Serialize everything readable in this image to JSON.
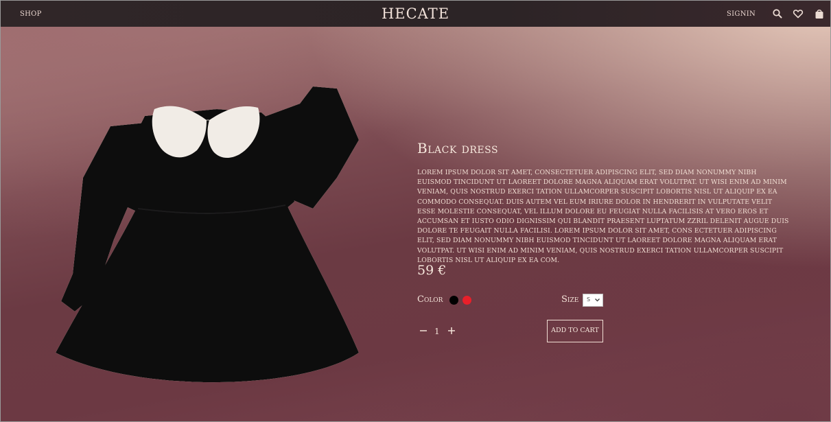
{
  "header": {
    "shop_label": "SHOP",
    "brand": "HECATE",
    "signin_label": "SIGNIN",
    "icons": [
      "search-icon",
      "heart-icon",
      "shopping-bag-icon"
    ]
  },
  "product": {
    "title": "Black dress",
    "description": "Lorem ipsum dolor sit amet, consectetuer adipiscing elit, sed diam nonummy nibh euismod tincidunt ut laoreet dolore magna aliquam erat volutpat. Ut wisi enim ad minim veniam, quis nostrud exerci tation ullamcorper suscipit lobortis nisl ut aliquip ex ea commodo consequat. Duis autem vel eum iriure dolor in hendrerit in vulputate velit esse molestie consequat, vel illum dolore eu feugiat nulla facilisis at vero eros et accumsan et iusto odio dignissim qui blandit praesent luptatum zzril delenit augue duis dolore te feugait nulla facilisi. Lorem ipsum dolor sit amet, cons ectetuer adipiscing elit, sed diam nonummy nibh euismod tincidunt ut laoreet dolore magna aliquam erat volutpat. Ut wisi enim ad minim veniam, quis nostrud exerci tation ullamcorper suscipit lobortis nisl ut aliquip ex ea com.",
    "price": "59 €",
    "color_label": "Color",
    "colors": [
      "#000000",
      "#e8202a"
    ],
    "size_label": "Size",
    "size_selected": "S",
    "quantity": "1",
    "add_to_cart_label": "ADD TO CART"
  }
}
